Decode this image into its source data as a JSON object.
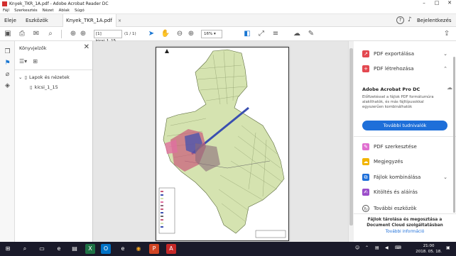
{
  "window": {
    "title": "Knyek_TKR_1A.pdf - Adobe Acrobat Reader DC",
    "controls": [
      "–",
      "□",
      "✕"
    ]
  },
  "menubar": [
    "Fájl",
    "Szerkesztés",
    "Nézet",
    "Ablak",
    "Súgó"
  ],
  "tabs": {
    "home": "Eleje",
    "tools": "Eszközök",
    "document": "Knyek_TKR_1A.pdf",
    "close": "×",
    "signin": "Bejelentkezés"
  },
  "toolbar": {
    "page_current": "[1] kicsi_1_15",
    "page_total": "(1 / 1)",
    "zoom": "16%"
  },
  "bookmarks_panel": {
    "title": "Könyvjelzők",
    "root": "Lapok és nézetek",
    "child": "kicsi_1_15"
  },
  "right_pane": {
    "items": [
      {
        "label": "PDF exportálása",
        "icon": "export-pdf-icon",
        "color": "#e34850"
      },
      {
        "label": "PDF létrehozása",
        "icon": "create-pdf-icon",
        "color": "#e34850"
      }
    ],
    "promo_title": "Adobe Acrobat Pro DC",
    "promo_text": "Előfizetéssel a fájlok PDF formátumúra alakíthatók, és más fájltípusokkal egyszerűen kombinálhatók",
    "promo_button": "További tudnivalók",
    "tools": [
      {
        "label": "PDF szerkesztése",
        "icon": "edit-pdf-icon",
        "color": "#e06fd0"
      },
      {
        "label": "Megjegyzés",
        "icon": "comment-icon",
        "color": "#f2b400"
      },
      {
        "label": "Fájlok kombinálása",
        "icon": "combine-files-icon",
        "color": "#1e6fd9"
      },
      {
        "label": "Kitöltés és aláírás",
        "icon": "fill-sign-icon",
        "color": "#9b4dca"
      },
      {
        "label": "További eszközök",
        "icon": "more-tools-icon",
        "color": "#555555"
      }
    ],
    "storage_text": "Fájlok tárolása és megosztása a Document Cloud szolgáltatásban",
    "storage_link": "További információ"
  },
  "taskbar": {
    "time": "21:00",
    "date": "2018. 05. 18."
  },
  "colors": {
    "accent": "#1e6fd9",
    "map_fill": "#d5e3b0",
    "map_urban": "#c95a7a",
    "map_blue": "#3a4fb0"
  }
}
